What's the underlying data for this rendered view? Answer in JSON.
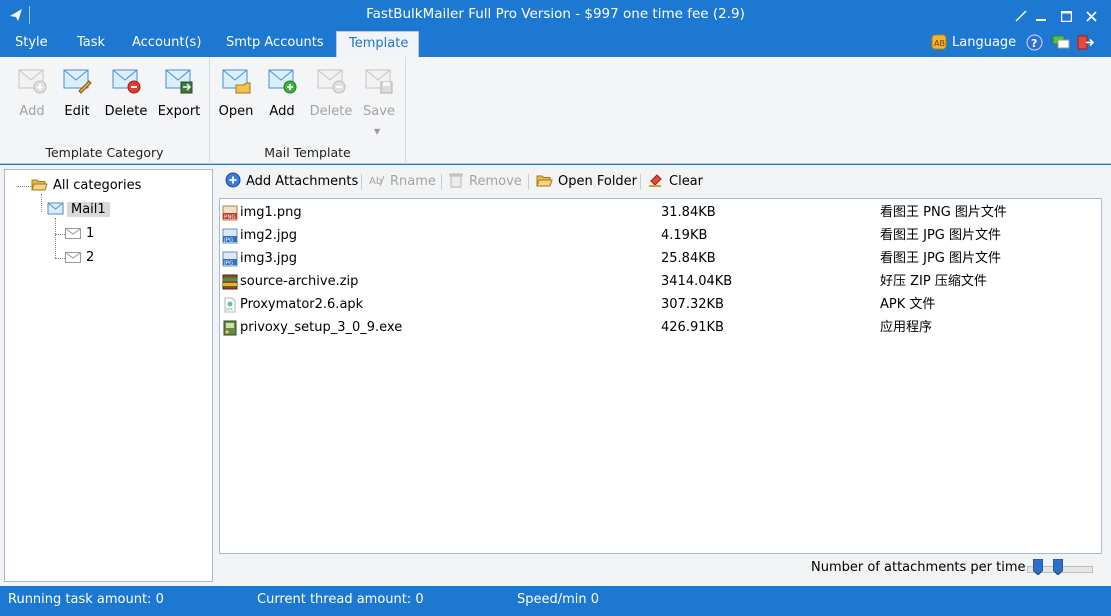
{
  "window": {
    "title": "FastBulkMailer Full Pro Version - $997 one time fee (2.9)"
  },
  "menu": {
    "tabs": [
      "Style",
      "Task",
      "Account(s)",
      "Smtp Accounts",
      "Template"
    ],
    "active_tab": "Template",
    "language_label": "Language"
  },
  "ribbon": {
    "template_category": {
      "label": "Template Category",
      "buttons": [
        {
          "label": "Add",
          "enabled": false
        },
        {
          "label": "Edit",
          "enabled": true
        },
        {
          "label": "Delete",
          "enabled": true
        },
        {
          "label": "Export",
          "enabled": true
        }
      ]
    },
    "mail_template": {
      "label": "Mail Template",
      "buttons": [
        {
          "label": "Open",
          "enabled": true
        },
        {
          "label": "Add",
          "enabled": true
        },
        {
          "label": "Delete",
          "enabled": false
        },
        {
          "label": "Save",
          "enabled": false
        }
      ]
    }
  },
  "tree": {
    "root": "All categories",
    "category": "Mail1",
    "items": [
      "1",
      "2"
    ]
  },
  "toolbar": {
    "add_attachments": "Add Attachments",
    "rename": "Rname",
    "remove": "Remove",
    "open_folder": "Open Folder",
    "clear": "Clear"
  },
  "files": [
    {
      "name": "img1.png",
      "size": "31.84KB",
      "type": "看图王 PNG 图片文件",
      "icon": "png-file-icon"
    },
    {
      "name": "img2.jpg",
      "size": "4.19KB",
      "type": "看图王 JPG 图片文件",
      "icon": "jpg-file-icon"
    },
    {
      "name": "img3.jpg",
      "size": "25.84KB",
      "type": "看图王 JPG 图片文件",
      "icon": "jpg-file-icon"
    },
    {
      "name": "source-archive.zip",
      "size": "3414.04KB",
      "type": "好压 ZIP 压缩文件",
      "icon": "zip-file-icon"
    },
    {
      "name": "Proxymator2.6.apk",
      "size": "307.32KB",
      "type": "APK 文件",
      "icon": "apk-file-icon"
    },
    {
      "name": "privoxy_setup_3_0_9.exe",
      "size": "426.91KB",
      "type": "应用程序",
      "icon": "exe-file-icon"
    }
  ],
  "attachments_per_time": {
    "label": "Number of attachments per time"
  },
  "status": {
    "running_task": "Running task amount:  0",
    "thread_amount": "Current thread amount:  0",
    "speed": "Speed/min  0"
  },
  "colors": {
    "brand": "#1c78d1",
    "disabled_text": "#a3a3a3"
  }
}
